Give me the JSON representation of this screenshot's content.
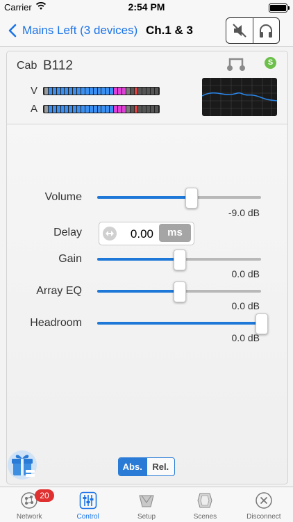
{
  "status_bar": {
    "carrier": "Carrier",
    "time": "2:54 PM"
  },
  "nav": {
    "back_label": "Mains Left (3 devices)",
    "title": "Ch.1 & 3",
    "buttons": [
      "mute-icon",
      "headphones-icon"
    ]
  },
  "cabinet": {
    "label": "Cab",
    "model": "B112",
    "solo_badge": "S",
    "meters": [
      {
        "label": "V",
        "level": 0.72
      },
      {
        "label": "A",
        "level": 0.72
      }
    ]
  },
  "controls": {
    "volume": {
      "label": "Volume",
      "value": "-9.0 dB",
      "position": 0.57
    },
    "delay": {
      "label": "Delay",
      "value": "0.00",
      "unit": "ms"
    },
    "gain": {
      "label": "Gain",
      "value": "0.0 dB",
      "position": 0.5
    },
    "array_eq": {
      "label": "Array EQ",
      "value": "0.0 dB",
      "position": 0.5
    },
    "headroom": {
      "label": "Headroom",
      "value": "0.0 dB",
      "position": 1.0
    }
  },
  "mode_toggle": {
    "abs": "Abs.",
    "rel": "Rel.",
    "selected": "Abs."
  },
  "tab_bar": [
    {
      "label": "Network",
      "icon": "network-icon",
      "badge": "20"
    },
    {
      "label": "Control",
      "icon": "sliders-icon",
      "active": true
    },
    {
      "label": "Setup",
      "icon": "setup-icon"
    },
    {
      "label": "Scenes",
      "icon": "scenes-icon"
    },
    {
      "label": "Disconnect",
      "icon": "disconnect-icon"
    }
  ],
  "colors": {
    "accent": "#1a73e8",
    "slider": "#1e78d8",
    "badge": "#e03030",
    "solo": "#6cc04a"
  }
}
